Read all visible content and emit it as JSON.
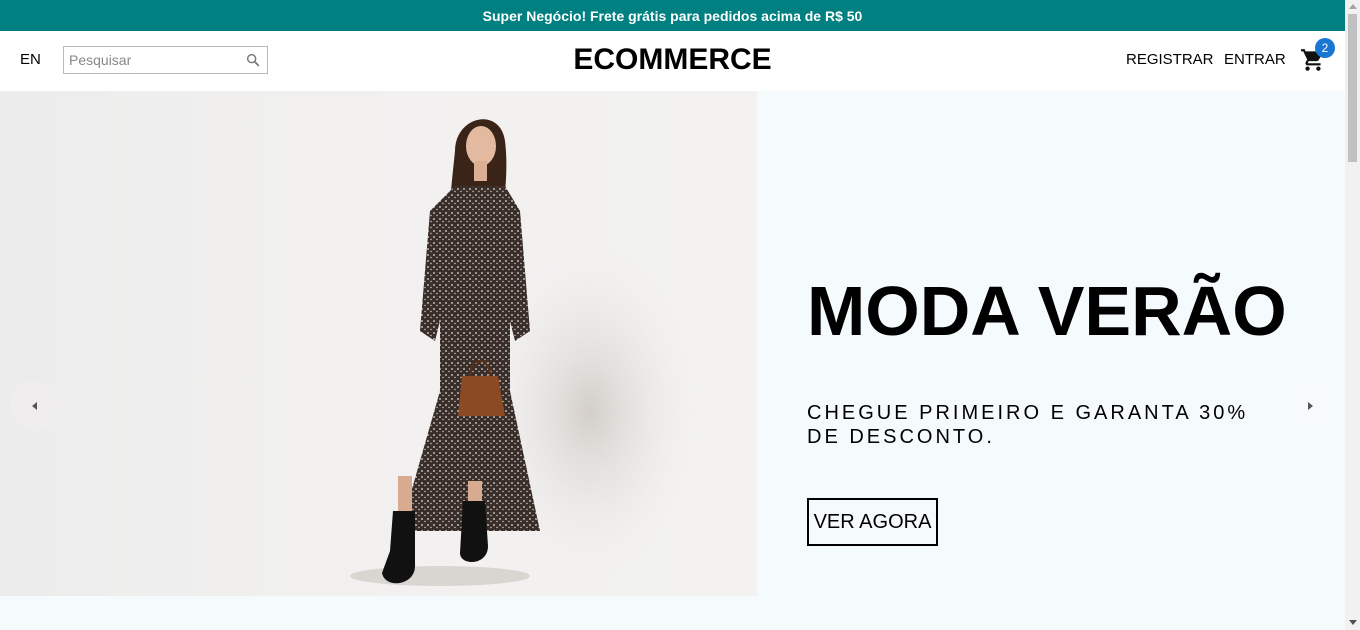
{
  "announcement": {
    "text": "Super Negócio! Frete grátis para pedidos acima de R$ 50"
  },
  "navbar": {
    "language": "EN",
    "search_placeholder": "Pesquisar",
    "logo": "ECOMMERCE",
    "register_label": "REGISTRAR",
    "login_label": "ENTRAR",
    "cart_count": "2",
    "icons": {
      "search": "search-icon",
      "cart": "shopping-cart-icon"
    }
  },
  "slider": {
    "title": "MODA VERÃO",
    "description": "CHEGUE PRIMEIRO E GARANTA 30% DE DESCONTO.",
    "button_label": "VER AGORA",
    "background_color": "#f5fafd",
    "icons": {
      "prev": "arrow-left-icon",
      "next": "arrow-right-icon"
    }
  },
  "colors": {
    "announcement_bg": "#008080",
    "badge": "#1976d2"
  }
}
